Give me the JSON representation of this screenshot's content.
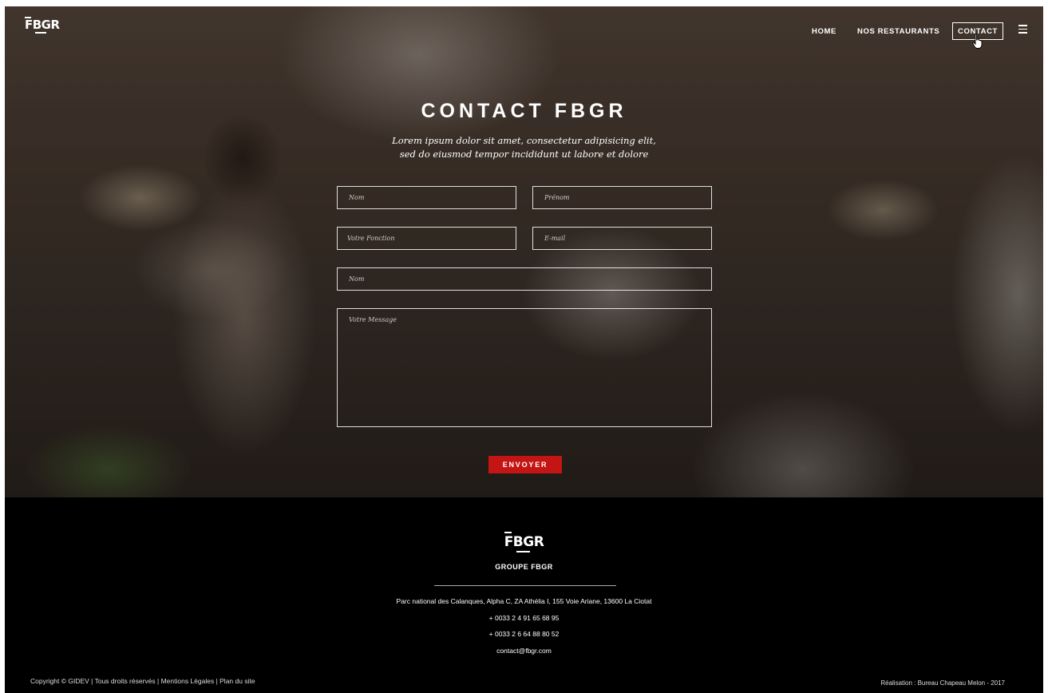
{
  "header": {
    "logo": "FBGR",
    "nav": [
      "HOME",
      "NOS RESTAURANTS",
      "CONTACT"
    ]
  },
  "hero": {
    "title": "CONTACT FBGR",
    "subtitle_line1": "Lorem ipsum dolor sit amet, consectetur adipisicing elit,",
    "subtitle_line2": "sed do eiusmod tempor incididunt ut labore et dolore"
  },
  "form": {
    "nom_placeholder": "Nom",
    "prenom_placeholder": "Prénom",
    "fonction_placeholder": "Votre Fonction",
    "email_placeholder": "E-mail",
    "nom2_placeholder": "Nom",
    "message_placeholder": "Votre Message",
    "submit_label": "ENVOYER"
  },
  "footer": {
    "logo": "FBGR",
    "group_name": "GROUPE FBGR",
    "address": "Parc national des Calanques, Alpha C, ZA Athélia I, 155 Voie Ariane, 13600 La Ciotat",
    "phone1": "+ 0033 2 4 91 65 68 95",
    "phone2": "+ 0033 2 6 64 88 80 52",
    "email": "contact@fbgr.com",
    "copyright": "Copyright © GIDEV | Tous droits réservés | Mentions Légales | Plan du site",
    "credit": "Réalisation : Bureau Chapeau Melon - 2017"
  },
  "colors": {
    "accent": "#c41414",
    "footer_bg": "#000000"
  },
  "icons": {
    "menu": "hamburger-icon",
    "cursor": "hand-pointer-icon"
  }
}
